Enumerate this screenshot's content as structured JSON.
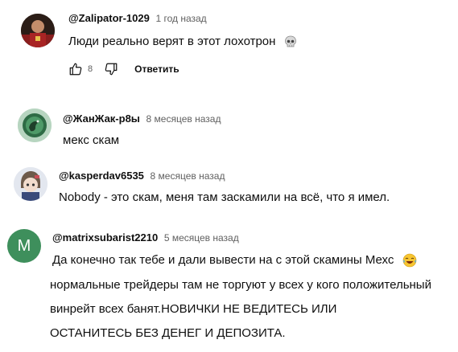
{
  "comments": [
    {
      "author": "@Zalipator-1029",
      "time": "1 год назад",
      "text": "Люди реально верят в этот лохотрон",
      "likes": "8",
      "reply_label": "Ответить",
      "emoji_icon": "skull-icon"
    },
    {
      "author": "@ЖанЖак-р8ы",
      "time": "8 месяцев назад",
      "text": "мекс скам"
    },
    {
      "author": "@kasperdav6535",
      "time": "8 месяцев назад",
      "text": "Nobody - это скам, меня там заскамили на всё, что я имел."
    },
    {
      "author": "@matrixsubarist2210",
      "time": "5 месяцев назад",
      "avatar_letter": "M",
      "avatar_color": "#3e8f5c",
      "lines": [
        "Да конечно так тебе и дали вывести на с этой скамины Мехс",
        "нормальные трейдеры там не торгуют у всех у кого положительный",
        "винрейт всех банят.НОВИЧКИ НЕ ВЕДИТЕСЬ ИЛИ",
        "ОСТАНИТЕСЬ БЕЗ ДЕНЕГ И ДЕПОЗИТА."
      ],
      "emoji_icon": "laughing-tears-icon"
    }
  ]
}
